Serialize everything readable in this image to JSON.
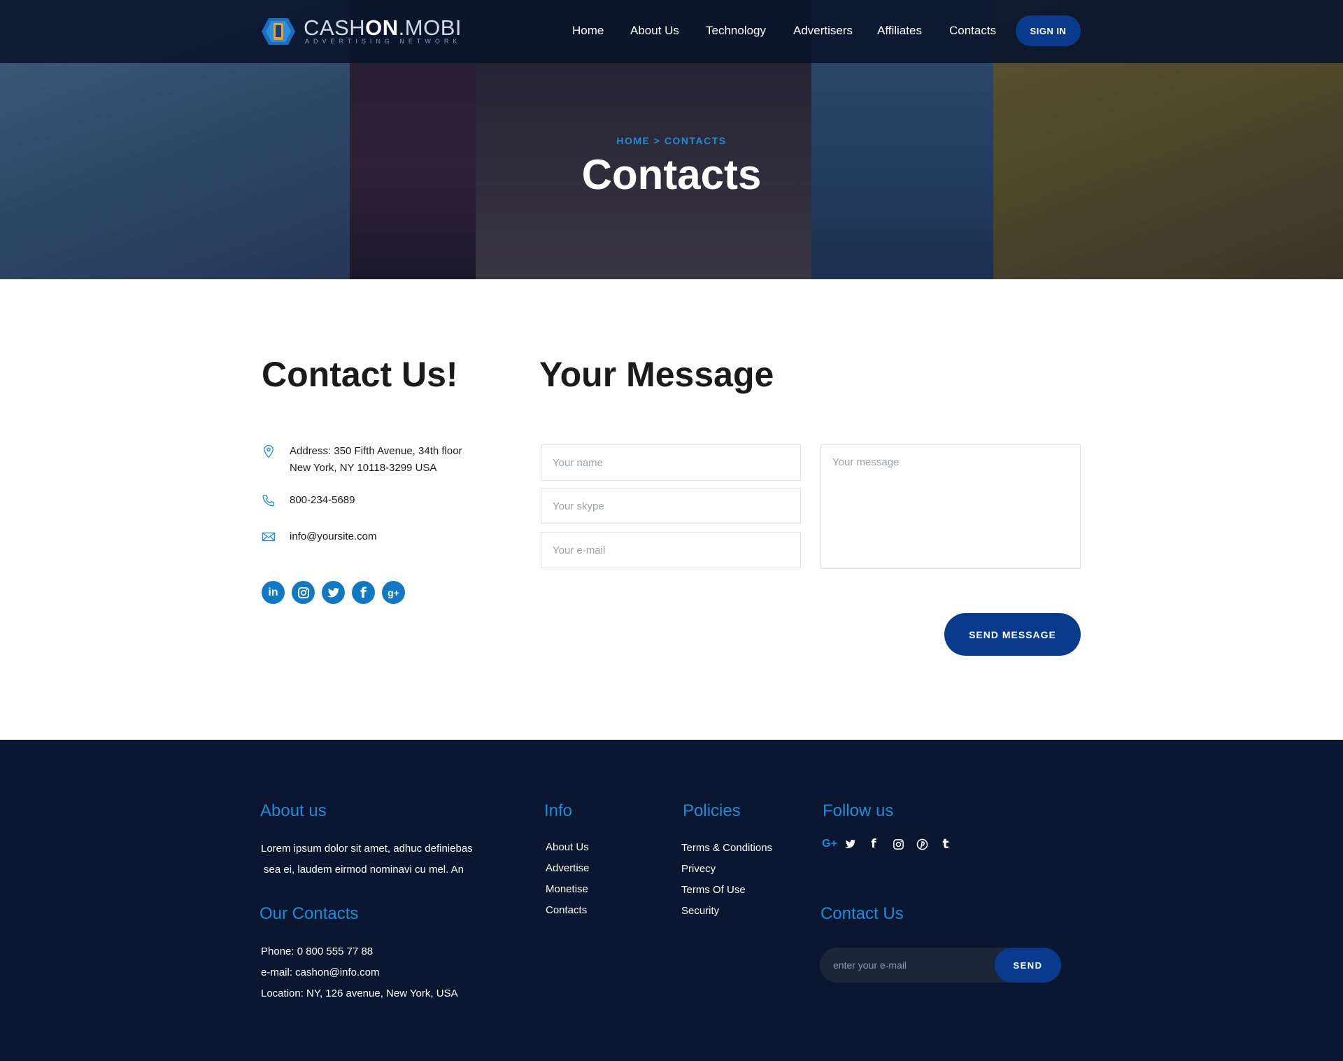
{
  "header": {
    "logo_text_light": "CASH",
    "logo_text_bold": "ON",
    "logo_text_tail": ".MOBI",
    "logo_tagline": "ADVERTISING NETWORK",
    "nav": [
      "Home",
      "About Us",
      "Technology",
      "Advertisers",
      "Affiliates",
      "Contacts"
    ],
    "signin_label": "SIGN IN"
  },
  "hero": {
    "breadcrumb": "HOME > CONTACTS",
    "title": "Contacts"
  },
  "contact": {
    "heading": "Contact Us!",
    "address_line1": "Address: 350 Fifth Avenue, 34th floor",
    "address_line2": "New York, NY 10118-3299 USA",
    "phone": "800-234-5689",
    "email": "info@yoursite.com",
    "socials": [
      "linkedin-icon",
      "instagram-icon",
      "twitter-icon",
      "facebook-icon",
      "google-plus-icon"
    ]
  },
  "form": {
    "heading": "Your Message",
    "name_placeholder": "Your name",
    "skype_placeholder": "Your skype",
    "email_placeholder": "Your e-mail",
    "message_placeholder": "Your message",
    "submit_label": "SEND MESSAGE"
  },
  "footer": {
    "about_heading": "About us",
    "about_line1": "Lorem ipsum dolor sit amet, adhuc definiebas",
    "about_line2": "sea ei, laudem eirmod nominavi cu mel. An",
    "contacts_heading": "Our Contacts",
    "phone": "Phone: 0 800 555 77 88",
    "email": "e-mail: cashon@info.com",
    "location": "Location: NY, 126 avenue, New York, USA",
    "info_heading": "Info",
    "info_links": [
      "About Us",
      "Advertise",
      "Monetise",
      "Contacts"
    ],
    "policies_heading": "Policies",
    "policies_links": [
      "Terms & Conditions",
      "Privecy",
      "Terms Of Use",
      "Security"
    ],
    "follow_heading": "Follow us",
    "follow_icons": [
      "google-plus-icon",
      "twitter-icon",
      "facebook-icon",
      "instagram-icon",
      "pinterest-icon",
      "tumblr-icon"
    ],
    "contact_us_heading": "Contact Us",
    "newsletter_placeholder": "enter your e-mail",
    "newsletter_button": "SEND"
  },
  "colors": {
    "accent": "#1a8fd8",
    "button": "#0a3a8c",
    "nav_bg": "#0a152c",
    "footer_bg": "#0b1630"
  }
}
